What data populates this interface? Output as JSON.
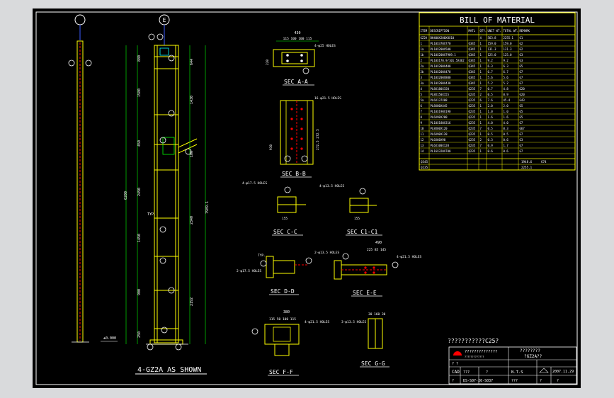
{
  "colors": {
    "bg": "#000000",
    "frame": "#ffffff",
    "yellow": "#ffff00",
    "cyan": "#00ffff",
    "green": "#00ff00",
    "red": "#ff0000",
    "blue": "#3c5cff",
    "magenta": "#ff00ff"
  },
  "elevation": {
    "grid_a": "",
    "grid_e": "E",
    "title": "4-GZ2A AS SHOWN",
    "dims_left": [
      "6200",
      "880",
      "1580",
      "450",
      "2490",
      "1450",
      "900",
      "250"
    ],
    "dims_right": [
      "644",
      "1430",
      "100",
      "2340",
      "2192",
      "7989.1"
    ],
    "level": "±0.000",
    "tag_typ": "TYP."
  },
  "sections": {
    "a": {
      "title": "SEC A-A",
      "dim_top": "430",
      "dims_sub": "115 100 100 115",
      "note": "4-φ25 HOLES",
      "dim_side": "220"
    },
    "b": {
      "title": "SEC B-B",
      "note": "16-φ21.5 HOLES",
      "dims_side": "930",
      "dims_right": "272.5 272.5"
    },
    "c": {
      "title": "SEC C-C",
      "note": "4-φ17.5 HOLES",
      "dims": "155"
    },
    "c1": {
      "title": "SEC C1-C1",
      "note": "4-φ13.5 HOLES",
      "dims": "155"
    },
    "d": {
      "title": "SEC D-D",
      "note_a": "2-φ17.5 HOLES",
      "note_b": "2-φ13.5 HOLES",
      "typ": "TYP."
    },
    "e": {
      "title": "SEC E-E",
      "dim_top": "490",
      "dims_sub": "225 85 145",
      "note": "4-φ21.5 HOLES"
    },
    "f": {
      "title": "SEC F-F",
      "dim_top": "380",
      "dims_sub": "115 50 100 115",
      "note": "4-φ21.5 HOLES"
    },
    "g": {
      "title": "SEC G-G",
      "dim_top": "30 160 30",
      "note": "3-φ13.5 HOLES"
    }
  },
  "bom": {
    "title": "BILL OF MATERIAL",
    "headers": [
      "ITEM",
      "DESCRIPTION",
      "MATL",
      "QTY.",
      "UNIT WT.",
      "TOTAL WT.",
      "REMARK"
    ],
    "rows": [
      [
        "GZ2A",
        "BH400X200X8X10",
        "",
        "4",
        "563.8",
        "2255.1",
        "G1"
      ],
      [
        "1",
        "PL10X370X770",
        "Q345",
        "1",
        "159.0",
        "159.0",
        "G2"
      ],
      [
        "1a",
        "PL10X200X500",
        "Q345",
        "1",
        "131.3",
        "131.3",
        "G2"
      ],
      [
        "1b",
        "PL10X200X7989.1",
        "Q345",
        "1",
        "125.0",
        "125.0",
        "G3"
      ],
      [
        "2",
        "PL10X170.9/101.5X462",
        "Q345",
        "1",
        "9.2",
        "9.2",
        "G3"
      ],
      [
        "2a",
        "PL10X200X400",
        "Q345",
        "1",
        "6.3",
        "6.3",
        "G5"
      ],
      [
        "2b",
        "PL10X200X470",
        "Q345",
        "1",
        "6.7",
        "6.7",
        "G7"
      ],
      [
        "3",
        "PL10X200X800",
        "Q345",
        "1",
        "5.6",
        "5.6",
        "G7"
      ],
      [
        "3a",
        "PL10X200X430",
        "Q345",
        "1",
        "5.2",
        "5.2",
        "G7"
      ],
      [
        "4",
        "PL8X180X150",
        "Q235",
        "7",
        "0.7",
        "4.8",
        "G20"
      ],
      [
        "5",
        "PL8X150X155",
        "Q235",
        "2",
        "0.5",
        "0.9",
        "G20"
      ],
      [
        "5a",
        "PL6X137X88",
        "Q235",
        "6",
        "7.6",
        "45.4",
        "G43"
      ],
      [
        "6",
        "PL8X80X445",
        "Q235",
        "1",
        "2.0",
        "2.0",
        "G5"
      ],
      [
        "7",
        "PL10X190X190",
        "Q235",
        "1",
        "1.0",
        "1.0",
        "G5"
      ],
      [
        "8",
        "PL6X90X280",
        "Q235",
        "1",
        "1.6",
        "1.6",
        "G5"
      ],
      [
        "9",
        "PL10X180X316",
        "Q235",
        "1",
        "4.0",
        "4.0",
        "G7"
      ],
      [
        "10",
        "PL8X80X120",
        "Q235",
        "7",
        "0.5",
        "0.3",
        "G67"
      ],
      [
        "11",
        "PL6X90X120",
        "Q235",
        "1",
        "0.5",
        "0.5",
        "G7"
      ],
      [
        "12",
        "PL6X60X90",
        "Q235",
        "2",
        "0.3",
        "0.6",
        "G3"
      ],
      [
        "13",
        "PL6X100X120",
        "Q235",
        "7",
        "0.9",
        "1.7",
        "G7"
      ],
      [
        "14",
        "PL16X320X700",
        "Q235",
        "1",
        "0.6",
        "0.6",
        "G7"
      ]
    ],
    "total_label_1": "Q345",
    "total_label_2": "Q235",
    "total_val_1": "1948.6",
    "total_val_2": "2255.1",
    "total_remark": "G74"
  },
  "titleblock": {
    "spec_note": "???????????C25?",
    "company": "??????????????",
    "company_sub": "?????????????",
    "drawing_name": "????????",
    "drawing_sub": "?GZ2A??",
    "cad_label": "CAD",
    "q1": "???",
    "q2": "?",
    "scale": "N.T.S",
    "date": "2007.11.29",
    "drawing_no": "DS-S07-26-S037",
    "q3": "?",
    "q4": "???",
    "q5": "?",
    "sheet": "?",
    "corner": "? ?"
  }
}
